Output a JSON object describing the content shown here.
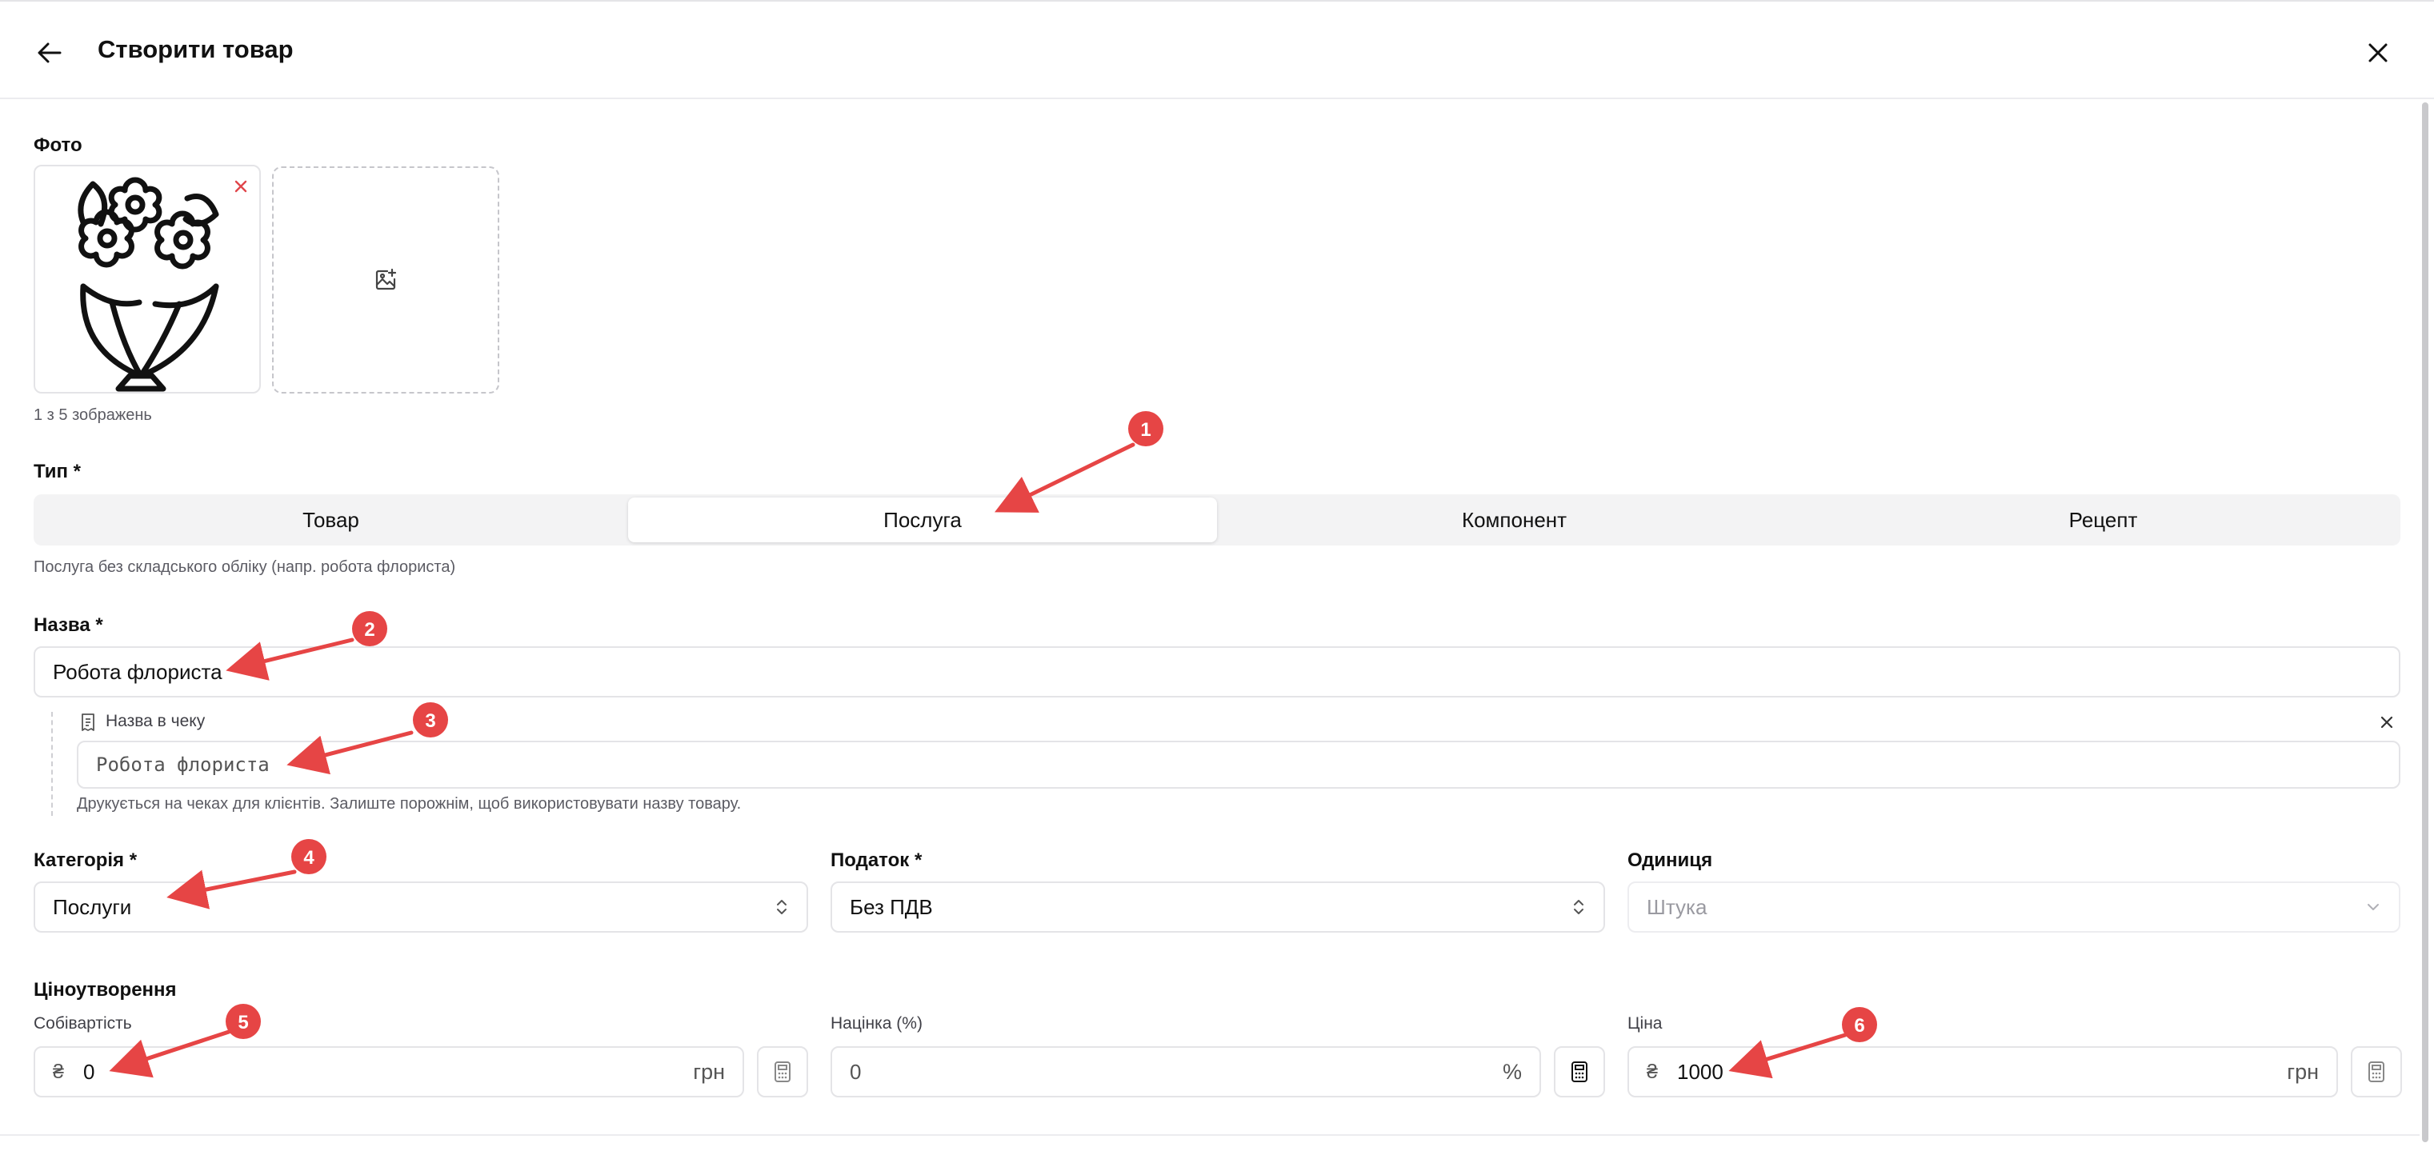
{
  "header": {
    "title": "Створити товар"
  },
  "photo": {
    "label": "Фото",
    "counter": "1 з 5 зображень"
  },
  "type": {
    "label": "Тип *",
    "options": [
      "Товар",
      "Послуга",
      "Компонент",
      "Рецепт"
    ],
    "selected": "Послуга",
    "hint": "Послуга без складського обліку (напр. робота флориста)"
  },
  "name": {
    "label": "Назва *",
    "value": "Робота флориста"
  },
  "receipt_name": {
    "label": "Назва в чеку",
    "value": "Робота флориста",
    "hint": "Друкується на чеках для клієнтів. Залиште порожнім, щоб використовувати назву товару."
  },
  "category": {
    "label": "Категорія *",
    "value": "Послуги"
  },
  "tax": {
    "label": "Податок *",
    "value": "Без ПДВ"
  },
  "unit": {
    "label": "Одиниця",
    "placeholder": "Штука"
  },
  "pricing": {
    "label": "Ціноутворення",
    "cost": {
      "label": "Собівартість",
      "currency": "₴",
      "value": "0",
      "unit": "грн"
    },
    "markup": {
      "label": "Націнка (%)",
      "value": "0",
      "unit": "%"
    },
    "price": {
      "label": "Ціна",
      "currency": "₴",
      "value": "1000",
      "unit": "грн"
    }
  },
  "annotations": [
    "1",
    "2",
    "3",
    "4",
    "5",
    "6"
  ],
  "colors": {
    "annotation": "#e64545",
    "border": "#e4e4e7"
  }
}
